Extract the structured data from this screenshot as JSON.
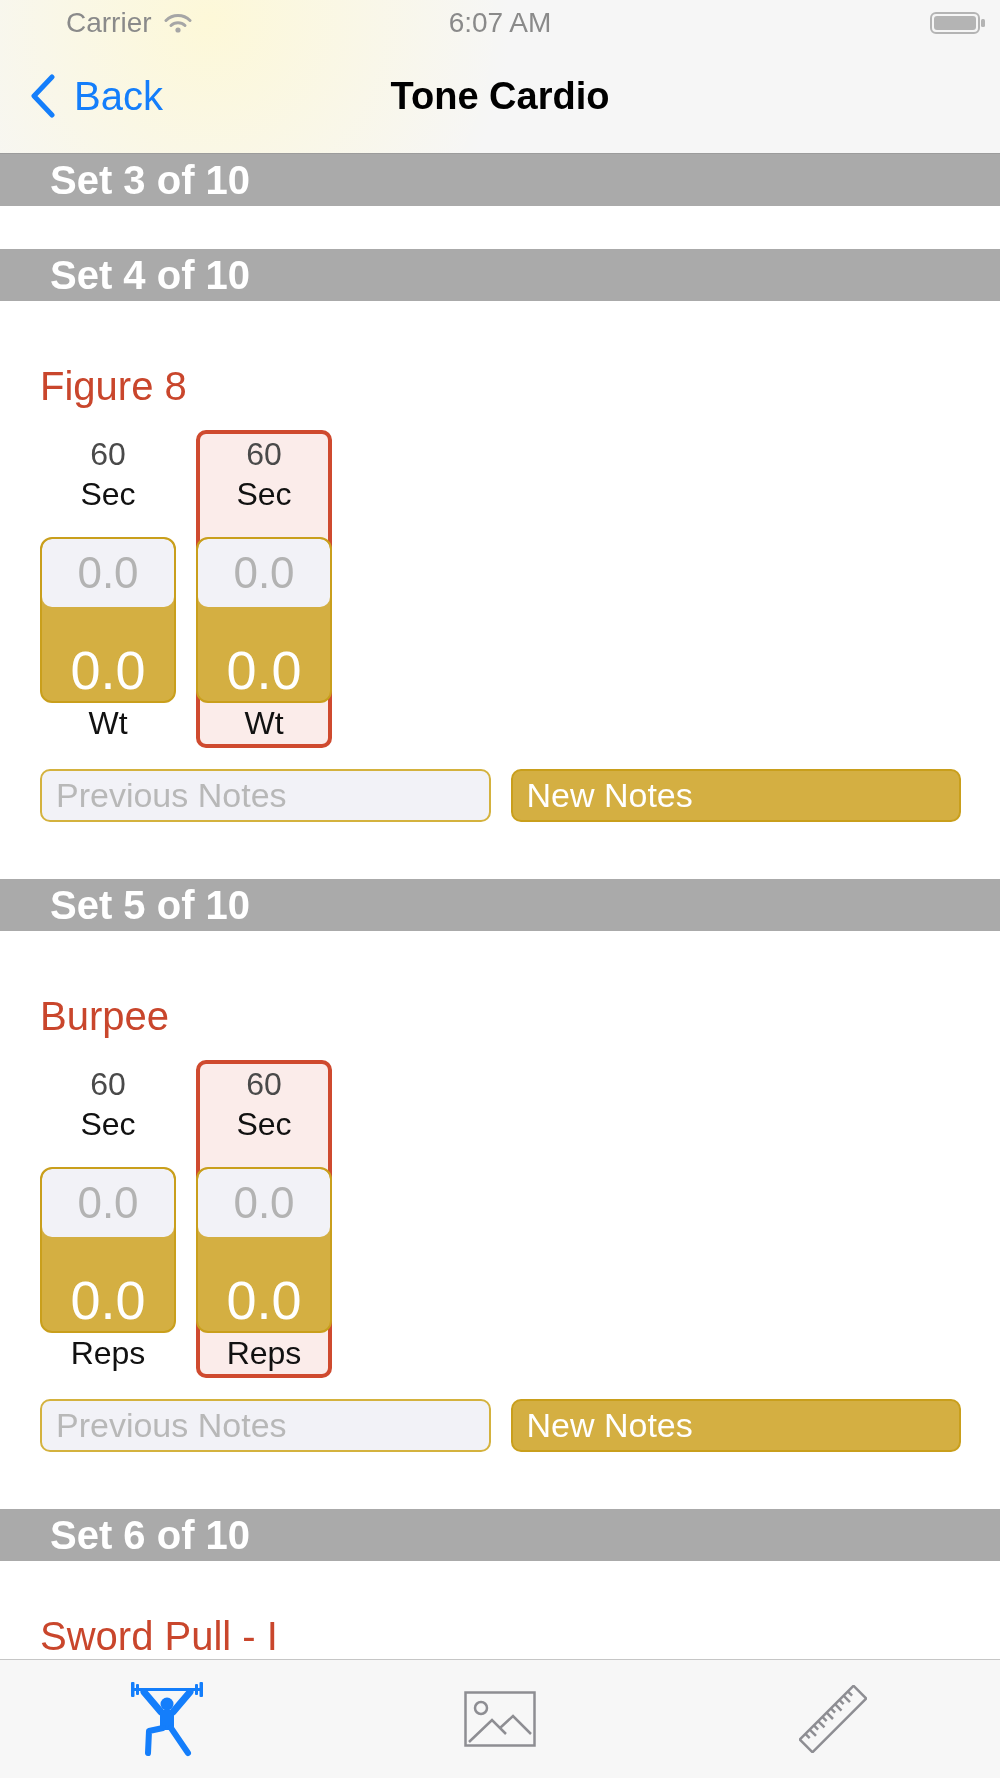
{
  "status_bar": {
    "carrier": "Carrier",
    "time": "6:07 AM"
  },
  "nav_bar": {
    "back": "Back",
    "title": "Tone Cardio"
  },
  "sets": [
    {
      "header": "Set 3 of 10"
    },
    {
      "header": "Set 4 of 10",
      "exercise": {
        "name": "Figure 8",
        "columns": [
          {
            "target": "60",
            "target_unit": "Sec",
            "placeholder": "0.0",
            "value": "0.0",
            "unit": "Wt",
            "selected": false
          },
          {
            "target": "60",
            "target_unit": "Sec",
            "placeholder": "0.0",
            "value": "0.0",
            "unit": "Wt",
            "selected": true
          }
        ],
        "previous_notes": {
          "placeholder": "Previous Notes"
        },
        "new_notes": {
          "placeholder": "New Notes"
        }
      }
    },
    {
      "header": "Set 5 of 10",
      "exercise": {
        "name": "Burpee",
        "columns": [
          {
            "target": "60",
            "target_unit": "Sec",
            "placeholder": "0.0",
            "value": "0.0",
            "unit": "Reps",
            "selected": false
          },
          {
            "target": "60",
            "target_unit": "Sec",
            "placeholder": "0.0",
            "value": "0.0",
            "unit": "Reps",
            "selected": true
          }
        ],
        "previous_notes": {
          "placeholder": "Previous Notes"
        },
        "new_notes": {
          "placeholder": "New Notes"
        }
      }
    },
    {
      "header": "Set 6 of 10",
      "exercise": {
        "name": "Sword Pull - I"
      }
    }
  ],
  "tab_bar": {
    "items": [
      {
        "kind": "workout",
        "selected": true
      },
      {
        "kind": "photos",
        "selected": false
      },
      {
        "kind": "measurements",
        "selected": false
      }
    ]
  }
}
